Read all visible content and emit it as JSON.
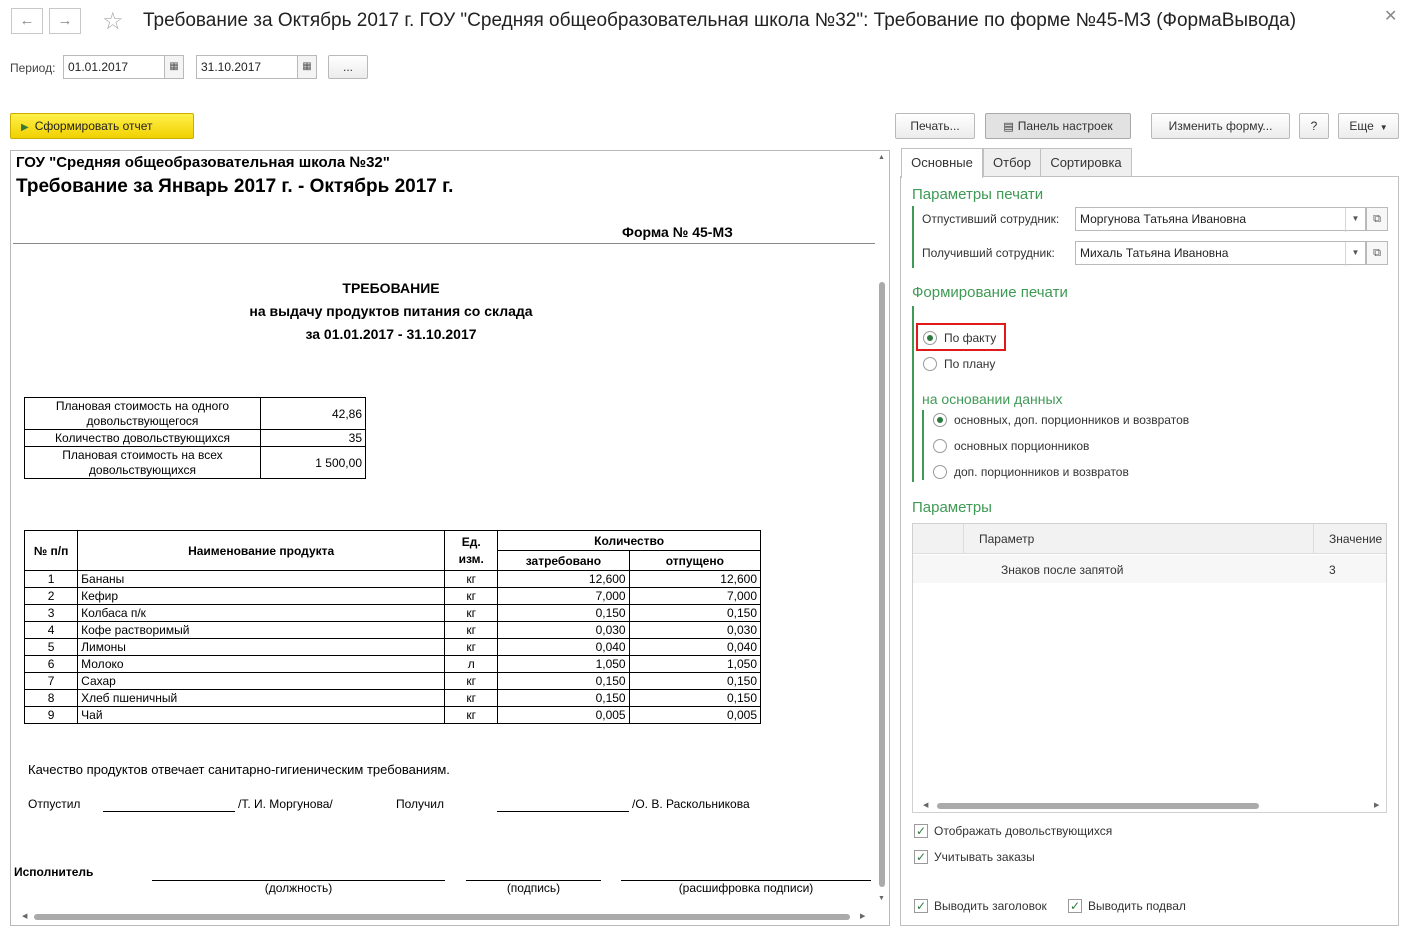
{
  "window": {
    "title": "Требование за Октябрь 2017 г. ГОУ \"Средняя общеобразовательная школа №32\": Требование по форме №45-МЗ (ФормаВывода)",
    "back_icon": "arrow-left-icon",
    "forward_icon": "arrow-right-icon",
    "favorite_icon": "star-icon",
    "close_icon": "close-icon"
  },
  "period": {
    "label": "Период:",
    "from": "01.01.2017",
    "to": "31.10.2017",
    "choose_label": "..."
  },
  "toolbar": {
    "generate_label": "Сформировать отчет",
    "print_label": "Печать...",
    "settings_panel_label": "Панель настроек",
    "change_form_label": "Изменить форму...",
    "help_label": "?",
    "more_label": "Еще"
  },
  "report": {
    "org": "ГОУ \"Средняя общеобразовательная школа №32\"",
    "heading": "Требование  за Январь 2017 г. - Октябрь 2017 г.",
    "form_no": "Форма № 45-МЗ",
    "doc_title": "ТРЕБОВАНИЕ",
    "doc_subtitle": "на выдачу продуктов питания со склада",
    "doc_period": "за 01.01.2017 - 31.10.2017",
    "summary": [
      {
        "label": "Плановая стоимость на одного довольствующегося",
        "value": "42,86"
      },
      {
        "label": "Количество довольствующихся",
        "value": "35"
      },
      {
        "label": "Плановая стоимость на всех довольствующихся",
        "value": "1 500,00"
      }
    ],
    "table_headers": {
      "num": "№ п/п",
      "name": "Наименование продукта",
      "unit": "Ед. изм.",
      "qty": "Количество",
      "requested": "затребовано",
      "released": "отпущено"
    },
    "rows": [
      {
        "n": "1",
        "name": "Бананы",
        "unit": "кг",
        "req": "12,600",
        "rel": "12,600"
      },
      {
        "n": "2",
        "name": "Кефир",
        "unit": "кг",
        "req": "7,000",
        "rel": "7,000"
      },
      {
        "n": "3",
        "name": "Колбаса п/к",
        "unit": "кг",
        "req": "0,150",
        "rel": "0,150"
      },
      {
        "n": "4",
        "name": "Кофе растворимый",
        "unit": "кг",
        "req": "0,030",
        "rel": "0,030"
      },
      {
        "n": "5",
        "name": "Лимоны",
        "unit": "кг",
        "req": "0,040",
        "rel": "0,040"
      },
      {
        "n": "6",
        "name": "Молоко",
        "unit": "л",
        "req": "1,050",
        "rel": "1,050"
      },
      {
        "n": "7",
        "name": "Сахар",
        "unit": "кг",
        "req": "0,150",
        "rel": "0,150"
      },
      {
        "n": "8",
        "name": "Хлеб пшеничный",
        "unit": "кг",
        "req": "0,150",
        "rel": "0,150"
      },
      {
        "n": "9",
        "name": "Чай",
        "unit": "кг",
        "req": "0,005",
        "rel": "0,005"
      }
    ],
    "quality_note": "Качество продуктов отвечает санитарно-гигиеническим требованиям.",
    "released_label": "Отпустил",
    "released_name": "/Т. И. Моргунова/",
    "received_label": "Получил",
    "received_name": "/О. В. Раскольникова",
    "executor_label": "Исполнитель",
    "position_caption": "(должность)",
    "signature_caption": "(подпись)",
    "decoding_caption": "(расшифровка подписи)"
  },
  "settings": {
    "tabs": [
      "Основные",
      "Отбор",
      "Сортировка"
    ],
    "print_params_title": "Параметры печати",
    "released_employee_label": "Отпустивший сотрудник:",
    "released_employee_value": "Моргунова Татьяна Ивановна",
    "received_employee_label": "Получивший сотрудник:",
    "received_employee_value": "Михаль Татьяна Ивановна",
    "print_forming_title": "Формирование печати",
    "by_fact": "По факту",
    "by_plan": "По плану",
    "based_on_title": "на основании данных",
    "based_on_options": [
      "основных, доп. порционников и возвратов",
      "основных порционников",
      "доп. порционников и возвратов"
    ],
    "params_title": "Параметры",
    "params_col_param": "Параметр",
    "params_col_value": "Значение",
    "params_row_name": "Знаков после запятой",
    "params_row_value": "3",
    "chk_show_eaters": "Отображать довольствующихся",
    "chk_orders": "Учитывать заказы",
    "chk_header": "Выводить заголовок",
    "chk_footer": "Выводить подвал"
  },
  "colors": {
    "accent_green": "#3f9a55",
    "generate_yellow": "#f5dd1a",
    "highlight_red": "#e0191b"
  }
}
